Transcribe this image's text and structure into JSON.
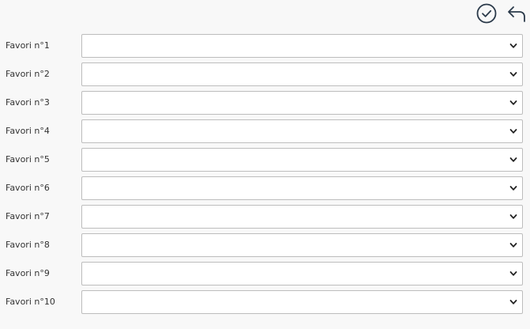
{
  "toolbar": {
    "confirm_icon": "check-circle-icon",
    "back_icon": "undo-arrow-icon",
    "icon_color": "#2b3a4a"
  },
  "form": {
    "fields": [
      {
        "label": "Favori n°1",
        "value": ""
      },
      {
        "label": "Favori n°2",
        "value": ""
      },
      {
        "label": "Favori n°3",
        "value": ""
      },
      {
        "label": "Favori n°4",
        "value": ""
      },
      {
        "label": "Favori n°5",
        "value": ""
      },
      {
        "label": "Favori n°6",
        "value": ""
      },
      {
        "label": "Favori n°7",
        "value": ""
      },
      {
        "label": "Favori n°8",
        "value": ""
      },
      {
        "label": "Favori n°9",
        "value": ""
      },
      {
        "label": "Favori n°10",
        "value": ""
      }
    ]
  }
}
